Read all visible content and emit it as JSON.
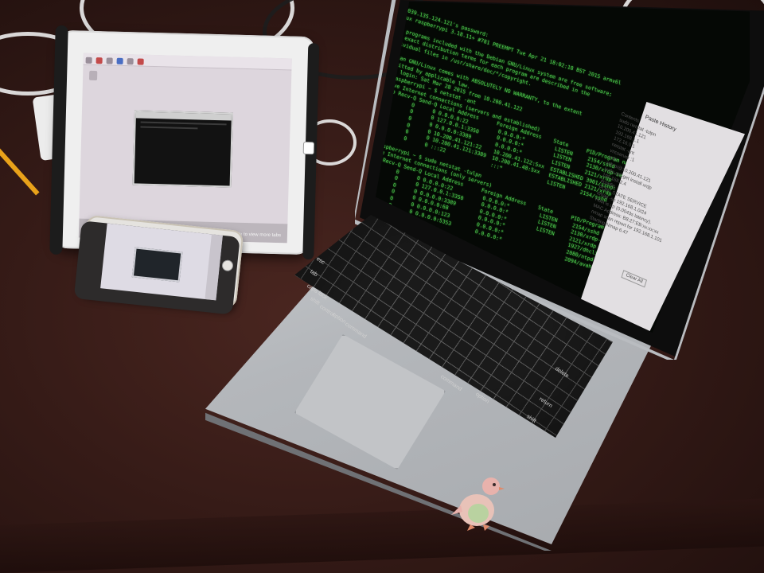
{
  "scene": {
    "description_items": [
      "ipad",
      "iphone",
      "macbook"
    ]
  },
  "ipad": {
    "hint_text": "< slide to view more tabs"
  },
  "macbook": {
    "terminal_lines": [
      "s:\\039.135.124.121's password:",
      "Linux raspberrypi 3.18.11+ #781 PREEMPT Tue Apr 21 18:02:18 BST 2015 armv6l",
      "",
      "The programs included with the Debian GNU/Linux system are free software;",
      "the exact distribution terms for each program are described in the",
      "individual files in /usr/share/doc/*/copyright.",
      "",
      "Debian GNU/Linux comes with ABSOLUTELY NO WARRANTY, to the extent",
      "permitted by applicable law.",
      "Last login: Sat Mar 28 2015 from 10.200.41.122",
      "pi@raspberrypi ~ $ netstat -ant",
      "Active Internet connections (servers and established)",
      "Proto Recv-Q Send-Q Local Address      Foreign Address    State      PID/Program name",
      "tcp        0      0 0.0.0.0:22          0.0.0.0:*          LISTEN     2154/sshd",
      "tcp        0      0 127.0.0.1:3350      0.0.0.0:*          LISTEN     2130/xrdp-sesman",
      "tcp        0      0 0.0.0.0:3389        0.0.0.0:*          LISTEN     2121/xrdp",
      "tcp        0      0 10.200.41.121:22    10.200.41.122:5xx  ESTABLISHED 3901/sshd: pi",
      "tcp        0      0 10.200.41.121:3389  10.200.41.48:5xx   ESTABLISHED 2121/xrdp",
      "tcp6       0      0 :::22               :::*               LISTEN     2154/sshd",
      "",
      "pi@raspberrypi ~ $ sudo netstat -tulpn",
      "Active Internet connections (only servers)",
      "Proto Recv-Q Send-Q Local Address      Foreign Address    State      PID/Program name",
      "tcp        0      0 0.0.0.0:22          0.0.0.0:*          LISTEN     2154/sshd",
      "tcp        0      0 127.0.0.1:3350      0.0.0.0:*          LISTEN     2130/xrdp-sesman",
      "tcp        0      0 0.0.0.0:3389        0.0.0.0:*          LISTEN     2121/xrdp",
      "udp        0      0 0.0.0.0:68          0.0.0.0:*                     1927/dhclient",
      "udp        0      0 0.0.0.0:123         0.0.0.0:*                     2080/ntpd",
      "udp        0      0 0.0.0.0:5353        0.0.0.0:*                     2094/avahi-daemon",
      "",
      "pi@raspberrypi ~ $"
    ],
    "paste_history": {
      "title": "Paste History",
      "items": [
        "Contents",
        "sudo netstat -tulpn",
        "10.200.41.121",
        "192.168.1.1",
        "172.16.0.1",
        "netstat -ant",
        "vncserver :1",
        "xrdp",
        "ssh pi@10.200.41.121",
        "sudo apt-get install xrdp",
        "192.168.2.4",
        "ifconfig",
        "PORT    STATE SERVICE",
        "nmap -sn 192.168.1.0/24",
        "Host is up (0.0043s latency).",
        "MAC Address: B8:27:EB:xx:xx:xx",
        "nmap scan report for 192.168.1.101",
        "Starting Nmap 6.47"
      ],
      "footer": "Clear All"
    },
    "keys": [
      "esc",
      "tab",
      "caps lock",
      "shift",
      "control",
      "option",
      "command",
      "command",
      "option",
      "return",
      "delete",
      "shift"
    ]
  },
  "colors": {
    "terminal_green": "#4fd14f",
    "desk": "#361b17",
    "aluminum": "#b4b7bb"
  }
}
